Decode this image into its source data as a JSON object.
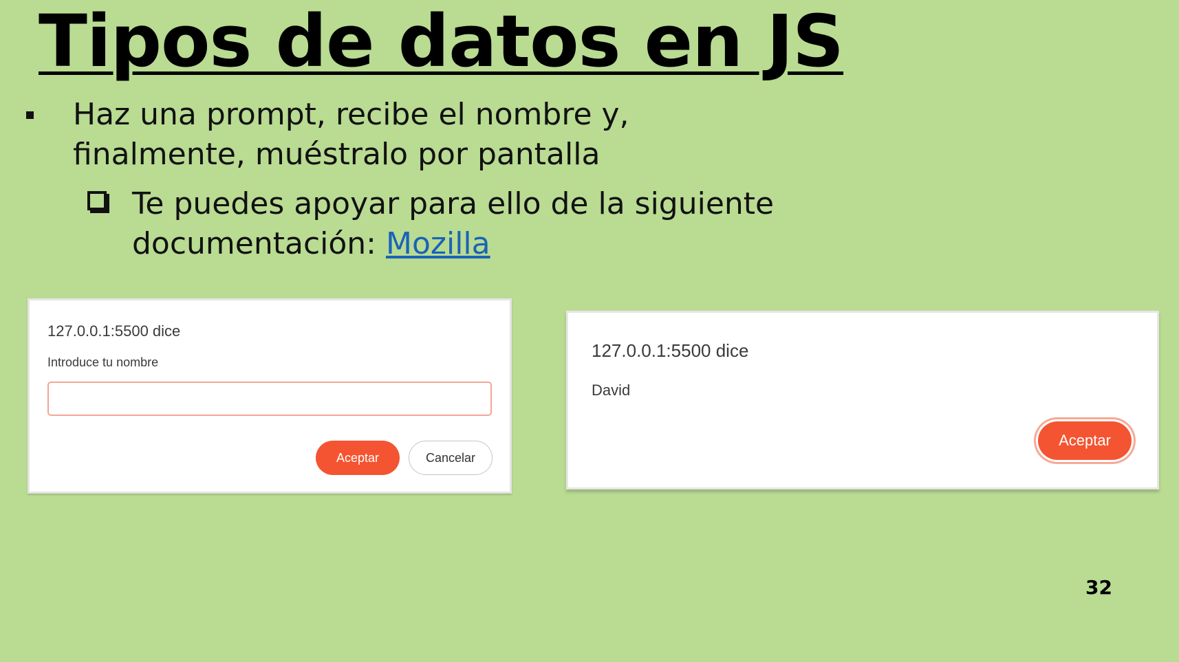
{
  "slide": {
    "title": "Tipos de datos en JS",
    "bullet1": "Haz una prompt, recibe el nombre y,",
    "bullet1_line2": "finalmente, muéstralo por pantalla",
    "bullet2_line1": "Te puedes apoyar para ello de la siguiente",
    "bullet2_prefix": "documentación: ",
    "bullet2_link": "Mozilla",
    "page_number": "32"
  },
  "prompt_dialog": {
    "origin": "127.0.0.1:5500 dice",
    "message": "Introduce tu nombre",
    "input_value": "",
    "ok_label": "Aceptar",
    "cancel_label": "Cancelar"
  },
  "alert_dialog": {
    "origin": "127.0.0.1:5500 dice",
    "message": "David",
    "ok_label": "Aceptar"
  },
  "colors": {
    "background": "#b9db92",
    "accent_button": "#f45431",
    "link": "#1a63b8"
  }
}
